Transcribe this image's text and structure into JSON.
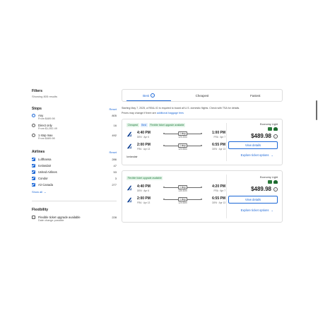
{
  "filters": {
    "title": "Filters",
    "results": "Showing 805 results"
  },
  "stops": {
    "title": "Stops",
    "reset": "Reset",
    "options": [
      {
        "label": "Any",
        "price": "From $489.98",
        "count": "805",
        "selected": true
      },
      {
        "label": "Direct only",
        "price": "From $1,052.49",
        "count": "16",
        "selected": false
      },
      {
        "label": "1 stop max",
        "price": "From $489.98",
        "count": "492",
        "selected": false
      }
    ]
  },
  "airlines": {
    "title": "Airlines",
    "reset": "Reset",
    "items": [
      {
        "name": "Lufthansa",
        "count": "286"
      },
      {
        "name": "Icelandair",
        "count": "47"
      },
      {
        "name": "United Airlines",
        "count": "53"
      },
      {
        "name": "Condor",
        "count": "3"
      },
      {
        "name": "Air Canada",
        "count": "277"
      }
    ],
    "show_all": "Show all"
  },
  "flexibility": {
    "title": "Flexibility",
    "option_label": "Flexible ticket upgrade available",
    "option_sub": "Date change possible",
    "option_count": "228"
  },
  "tabs": [
    "Best",
    "Cheapest",
    "Fastest"
  ],
  "notice": {
    "line1": "Starting May 7, 2025, a REAL ID is required to board all U.S. domestic flights. Check with TSA for details.",
    "line2": "Prices may change if there are",
    "link": "additional baggage fees"
  },
  "cards": [
    {
      "badges": [
        "Cheapest",
        "Best",
        "Flexible ticket upgrade available"
      ],
      "legs": [
        {
          "dep_time": "4:40 PM",
          "dep_info": "DEN · Apr 6",
          "stops": "1 stop",
          "duration": "12h 20m",
          "arr_time": "1:00 PM",
          "arr_info": "FRA · Apr 7"
        },
        {
          "dep_time": "2:00 PM",
          "dep_info": "FRA · Apr 13",
          "stops": "1 stop",
          "duration": "12h 55m",
          "arr_time": "6:55 PM",
          "arr_info": "DEN · Apr 13"
        }
      ],
      "carrier": "Icelandair",
      "fare_class": "Economy Light",
      "price": "$489.98",
      "button": "View details",
      "explore": "Explore ticket options"
    },
    {
      "badges": [
        "Flexible ticket upgrade available"
      ],
      "legs": [
        {
          "dep_time": "4:40 PM",
          "dep_info": "DEN · Apr 6",
          "stops": "1 stop",
          "duration": "13h 40m",
          "arr_time": "4:20 PM",
          "arr_info": "FRA · Apr 7"
        },
        {
          "dep_time": "2:00 PM",
          "dep_info": "FRA · Apr 13",
          "stops": "1 stop",
          "duration": "12h 55m",
          "arr_time": "6:55 PM",
          "arr_info": "DEN · Apr 13"
        }
      ],
      "carrier": "",
      "fare_class": "Economy Light",
      "price": "$489.98",
      "button": "View details",
      "explore": "Explore ticket options"
    }
  ],
  "colors": {
    "accent": "#1a66d6",
    "badge_green": "#1d7a3a",
    "airline_logo": "#0b3d91"
  }
}
